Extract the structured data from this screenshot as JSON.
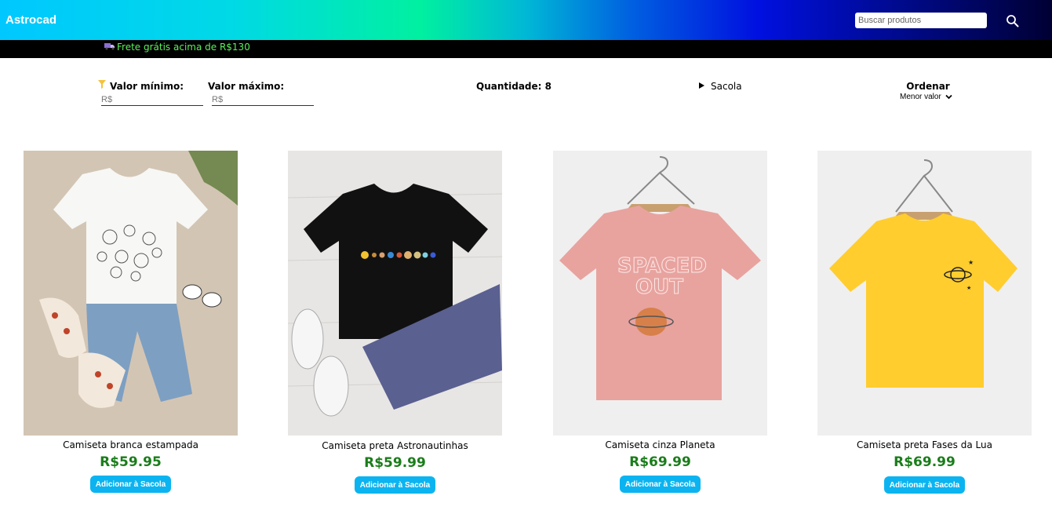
{
  "header": {
    "logo": "Astrocad",
    "search_placeholder": "Buscar produtos"
  },
  "promo": {
    "text": "Frete grátis acima de R$130"
  },
  "filters": {
    "min_label": "Valor mínimo:",
    "max_label": "Valor máximo:",
    "min_placeholder": "R$",
    "max_placeholder": "R$",
    "quantity_label": "Quantidade: 8",
    "bag_label": "Sacola",
    "sort_title": "Ordenar",
    "sort_selected": "Menor valor"
  },
  "products": [
    {
      "name": "Camiseta branca estampada",
      "price": "R$59.95",
      "button": "Adicionar à Sacola",
      "shirt_color": "#ffffff",
      "bg": "#d3c5b4"
    },
    {
      "name": "Camiseta preta Astronautinhas",
      "price": "R$59.99",
      "button": "Adicionar à Sacola",
      "shirt_color": "#111111",
      "bg": "#e8e6e4"
    },
    {
      "name": "Camiseta cinza Planeta",
      "price": "R$69.99",
      "button": "Adicionar à Sacola",
      "shirt_color": "#e8a39f",
      "bg": "#f0efef"
    },
    {
      "name": "Camiseta preta Fases da Lua",
      "price": "R$69.99",
      "button": "Adicionar à Sacola",
      "shirt_color": "#ffcd2e",
      "bg": "#f0efef"
    }
  ]
}
